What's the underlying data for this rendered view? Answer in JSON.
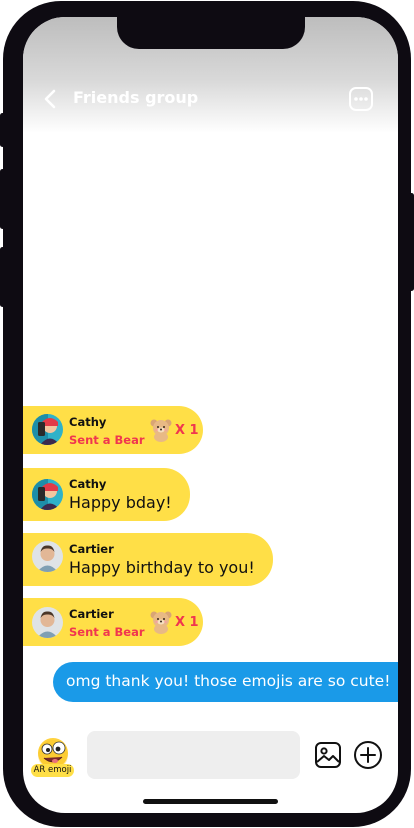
{
  "header": {
    "title": "Friends group"
  },
  "messages": [
    {
      "type": "gift",
      "name": "Cathy",
      "action": "Sent a Bear",
      "count": "X 1",
      "avatar": "cathy-avatar",
      "icon": "bear-icon"
    },
    {
      "type": "text",
      "name": "Cathy",
      "text": "Happy bday!",
      "avatar": "cathy-avatar"
    },
    {
      "type": "text",
      "name": "Cartier",
      "text": "Happy birthday to you!",
      "avatar": "cartier-avatar"
    },
    {
      "type": "gift",
      "name": "Cartier",
      "action": "Sent a Bear",
      "count": "X 1",
      "avatar": "cartier-avatar",
      "icon": "bear-icon"
    },
    {
      "type": "outgoing",
      "text": "omg thank you! those emojis are so cute!"
    }
  ],
  "composer": {
    "ar_label": "AR emoji"
  },
  "colors": {
    "incoming_bubble": "#ffdf47",
    "outgoing_bubble": "#1a9ae8",
    "gift_action": "#f0364f",
    "input_bg": "#eeeeee"
  },
  "icons": [
    "back-chevron-icon",
    "more-options-icon",
    "bear-icon",
    "ar-emoji-icon",
    "image-icon",
    "add-circle-icon"
  ]
}
